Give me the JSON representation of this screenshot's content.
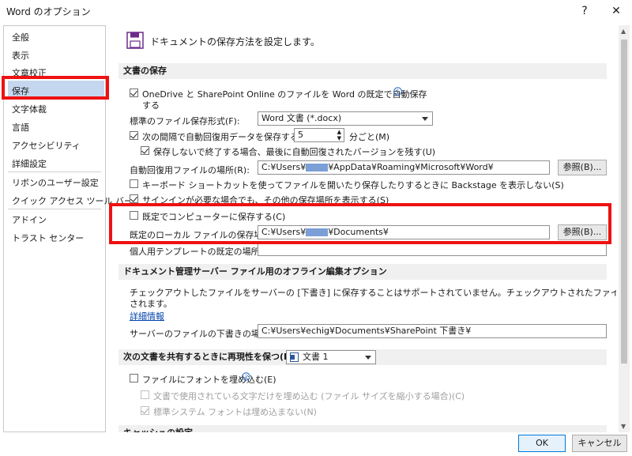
{
  "window": {
    "title": "Word のオプション",
    "help": "?",
    "close": "✕"
  },
  "nav": {
    "items": [
      "全般",
      "表示",
      "文章校正",
      "保存",
      "文字体裁",
      "言語",
      "アクセシビリティ",
      "詳細設定",
      "リボンのユーザー設定",
      "クイック アクセス ツール バー",
      "アドイン",
      "トラスト センター"
    ]
  },
  "header": {
    "title": "ドキュメントの保存方法を設定します。"
  },
  "save": {
    "section": "文書の保存",
    "onedrive_label": "OneDrive と SharePoint Online のファイルを Word の既定で自動保存",
    "onedrive_label2": "する",
    "format_label": "標準のファイル保存形式(F):",
    "format_value": "Word 文書 (*.docx)",
    "autorecover_label": "次の間隔で自動回復用データを保存する(A):",
    "autorecover_value": "5",
    "autorecover_unit": "分ごと(M)",
    "keep_last_label": "保存しないで終了する場合、最後に自動回復されたバージョンを残す(U)",
    "autorecover_loc_label": "自動回復用ファイルの場所(R):",
    "autorecover_loc_pre": "C:¥Users¥",
    "autorecover_loc_post": "¥AppData¥Roaming¥Microsoft¥Word¥",
    "browse1": "参照(B)...",
    "backstage_label": "キーボード ショートカットを使ってファイルを開いたり保存したりするときに Backstage を表示しない(S)",
    "signin_label": "サインインが必要な場合でも、その他の保存場所を表示する(S)",
    "local_default_label": "既定でコンピューターに保存する(C)",
    "local_loc_label": "既定のローカル ファイルの保存場所(I):",
    "local_loc_pre": "C:¥Users¥",
    "local_loc_post": "¥Documents¥",
    "browse2": "参照(B)...",
    "template_loc_label": "個人用テンプレートの既定の場所(T):"
  },
  "offline": {
    "section": "ドキュメント管理サーバー ファイル用のオフライン編集オプション",
    "desc1": "チェックアウトしたファイルをサーバーの [下書き] に保存することはサポートされていません。チェックアウトされたファイルは Office ドキュメント キャッシュに保存",
    "desc2": "されます。",
    "more_info": "詳細情報",
    "drafts_label": "サーバーのファイルの下書きの場所(V):",
    "drafts_value": "C:¥Users¥echig¥Documents¥SharePoint 下書き¥"
  },
  "fidelity": {
    "section": "次の文書を共有するときに再現性を保つ(D):",
    "doc_value": "文書 1",
    "embed_label": "ファイルにフォントを埋め込む(E)",
    "embed_used_label": "文書で使用されている文字だけを埋め込む (ファイル サイズを縮小する場合)(C)",
    "no_common_label": "標準システム フォントは埋め込まない(N)"
  },
  "cache": {
    "section": "キャッシュの設定"
  },
  "footer": {
    "ok": "OK",
    "cancel": "キャンセル"
  },
  "colors": {
    "highlight_red": "#ee1111",
    "nav_selected": "#c5d7ee"
  }
}
